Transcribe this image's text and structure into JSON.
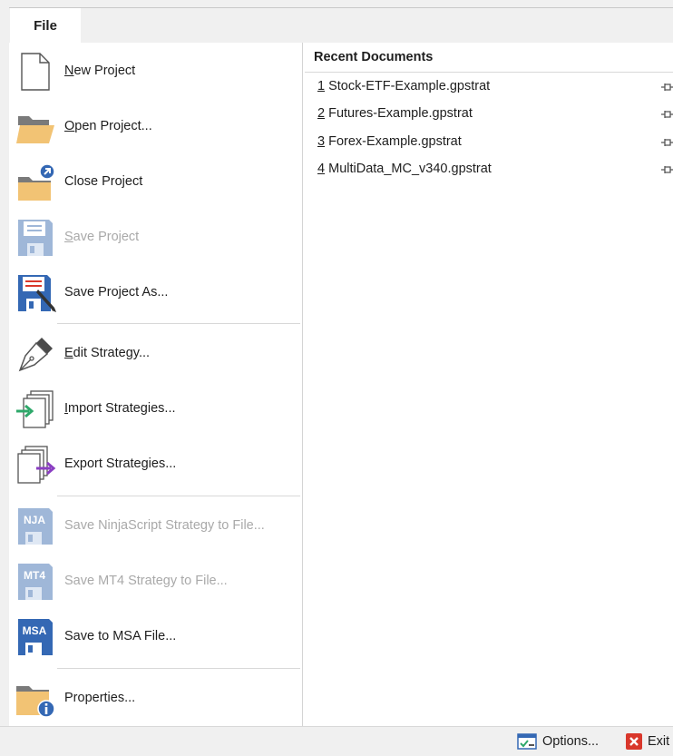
{
  "tab": {
    "label": "File"
  },
  "menu": [
    {
      "id": "new-project",
      "label": "New Project",
      "enabled": true,
      "icon": "new-document-icon"
    },
    {
      "id": "open-project",
      "label": "Open Project...",
      "enabled": true,
      "icon": "open-folder-icon"
    },
    {
      "id": "close-project",
      "label": "Close Project",
      "enabled": true,
      "icon": "close-folder-icon"
    },
    {
      "id": "save-project",
      "label": "Save Project",
      "enabled": false,
      "icon": "floppy-disk-icon"
    },
    {
      "id": "save-project-as",
      "label": "Save Project As...",
      "enabled": true,
      "icon": "save-as-icon"
    },
    {
      "id": "edit-strategy",
      "label": "Edit Strategy...",
      "enabled": true,
      "icon": "fountain-pen-icon"
    },
    {
      "id": "import-strategies",
      "label": "Import Strategies...",
      "enabled": true,
      "icon": "import-pages-icon"
    },
    {
      "id": "export-strategies",
      "label": "Export Strategies...",
      "enabled": true,
      "icon": "export-pages-icon"
    },
    {
      "id": "save-ninjascript",
      "label": "Save NinjaScript Strategy to File...",
      "enabled": false,
      "icon": "nja-disk-icon",
      "badge": "NJA"
    },
    {
      "id": "save-mt4",
      "label": "Save MT4 Strategy to File...",
      "enabled": false,
      "icon": "mt4-disk-icon",
      "badge": "MT4"
    },
    {
      "id": "save-msa",
      "label": "Save to MSA File...",
      "enabled": true,
      "icon": "msa-disk-icon",
      "badge": "MSA"
    },
    {
      "id": "properties",
      "label": "Properties...",
      "enabled": true,
      "icon": "folder-info-icon"
    }
  ],
  "recent": {
    "header": "Recent Documents",
    "items": [
      {
        "num": "1",
        "name": "Stock-ETF-Example.gpstrat"
      },
      {
        "num": "2",
        "name": "Futures-Example.gpstrat"
      },
      {
        "num": "3",
        "name": "Forex-Example.gpstrat"
      },
      {
        "num": "4",
        "name": "MultiData_MC_v340.gpstrat"
      }
    ]
  },
  "footer": {
    "options_label": "Options...",
    "exit_label": "Exit"
  },
  "colors": {
    "folder": "#f2c374",
    "disk": "#3468b4",
    "disk_disabled": "#9fb7d8",
    "accent_green": "#2ea86a",
    "accent_purple": "#8a3ec2",
    "exit_red": "#d9372b",
    "disabled_text": "#a9a9a9"
  }
}
